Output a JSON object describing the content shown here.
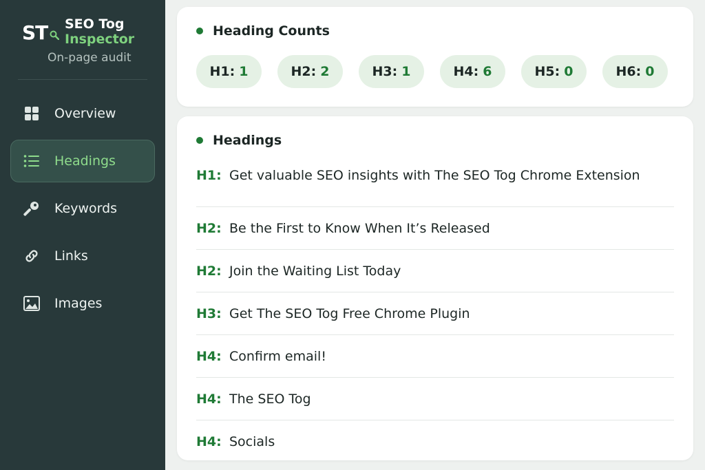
{
  "brand": {
    "logo": "ST",
    "name": "SEO Tog",
    "sub": "Inspector",
    "tagline": "On-page audit"
  },
  "nav": [
    {
      "label": "Overview",
      "icon": "grid-icon",
      "active": false
    },
    {
      "label": "Headings",
      "icon": "list-icon",
      "active": true
    },
    {
      "label": "Keywords",
      "icon": "key-icon",
      "active": false
    },
    {
      "label": "Links",
      "icon": "link-icon",
      "active": false
    },
    {
      "label": "Images",
      "icon": "image-icon",
      "active": false
    }
  ],
  "counts": {
    "title": "Heading Counts",
    "items": [
      {
        "label": "H1:",
        "value": "1"
      },
      {
        "label": "H2:",
        "value": "2"
      },
      {
        "label": "H3:",
        "value": "1"
      },
      {
        "label": "H4:",
        "value": "6"
      },
      {
        "label": "H5:",
        "value": "0"
      },
      {
        "label": "H6:",
        "value": "0"
      }
    ]
  },
  "headings": {
    "title": "Headings",
    "items": [
      {
        "level": "H1:",
        "text": "Get valuable SEO insights with The SEO Tog Chrome Extension"
      },
      {
        "level": "H2:",
        "text": "Be the First to Know When It’s Released"
      },
      {
        "level": "H2:",
        "text": "Join the Waiting List Today"
      },
      {
        "level": "H3:",
        "text": "Get The SEO Tog Free Chrome Plugin"
      },
      {
        "level": "H4:",
        "text": "Confirm email!"
      },
      {
        "level": "H4:",
        "text": "The SEO Tog"
      },
      {
        "level": "H4:",
        "text": "Socials"
      }
    ]
  },
  "colors": {
    "sidebar_bg": "#28393a",
    "accent_green": "#1f7a35",
    "active_text": "#8fdc8c",
    "chip_bg": "#e5f1e5"
  }
}
